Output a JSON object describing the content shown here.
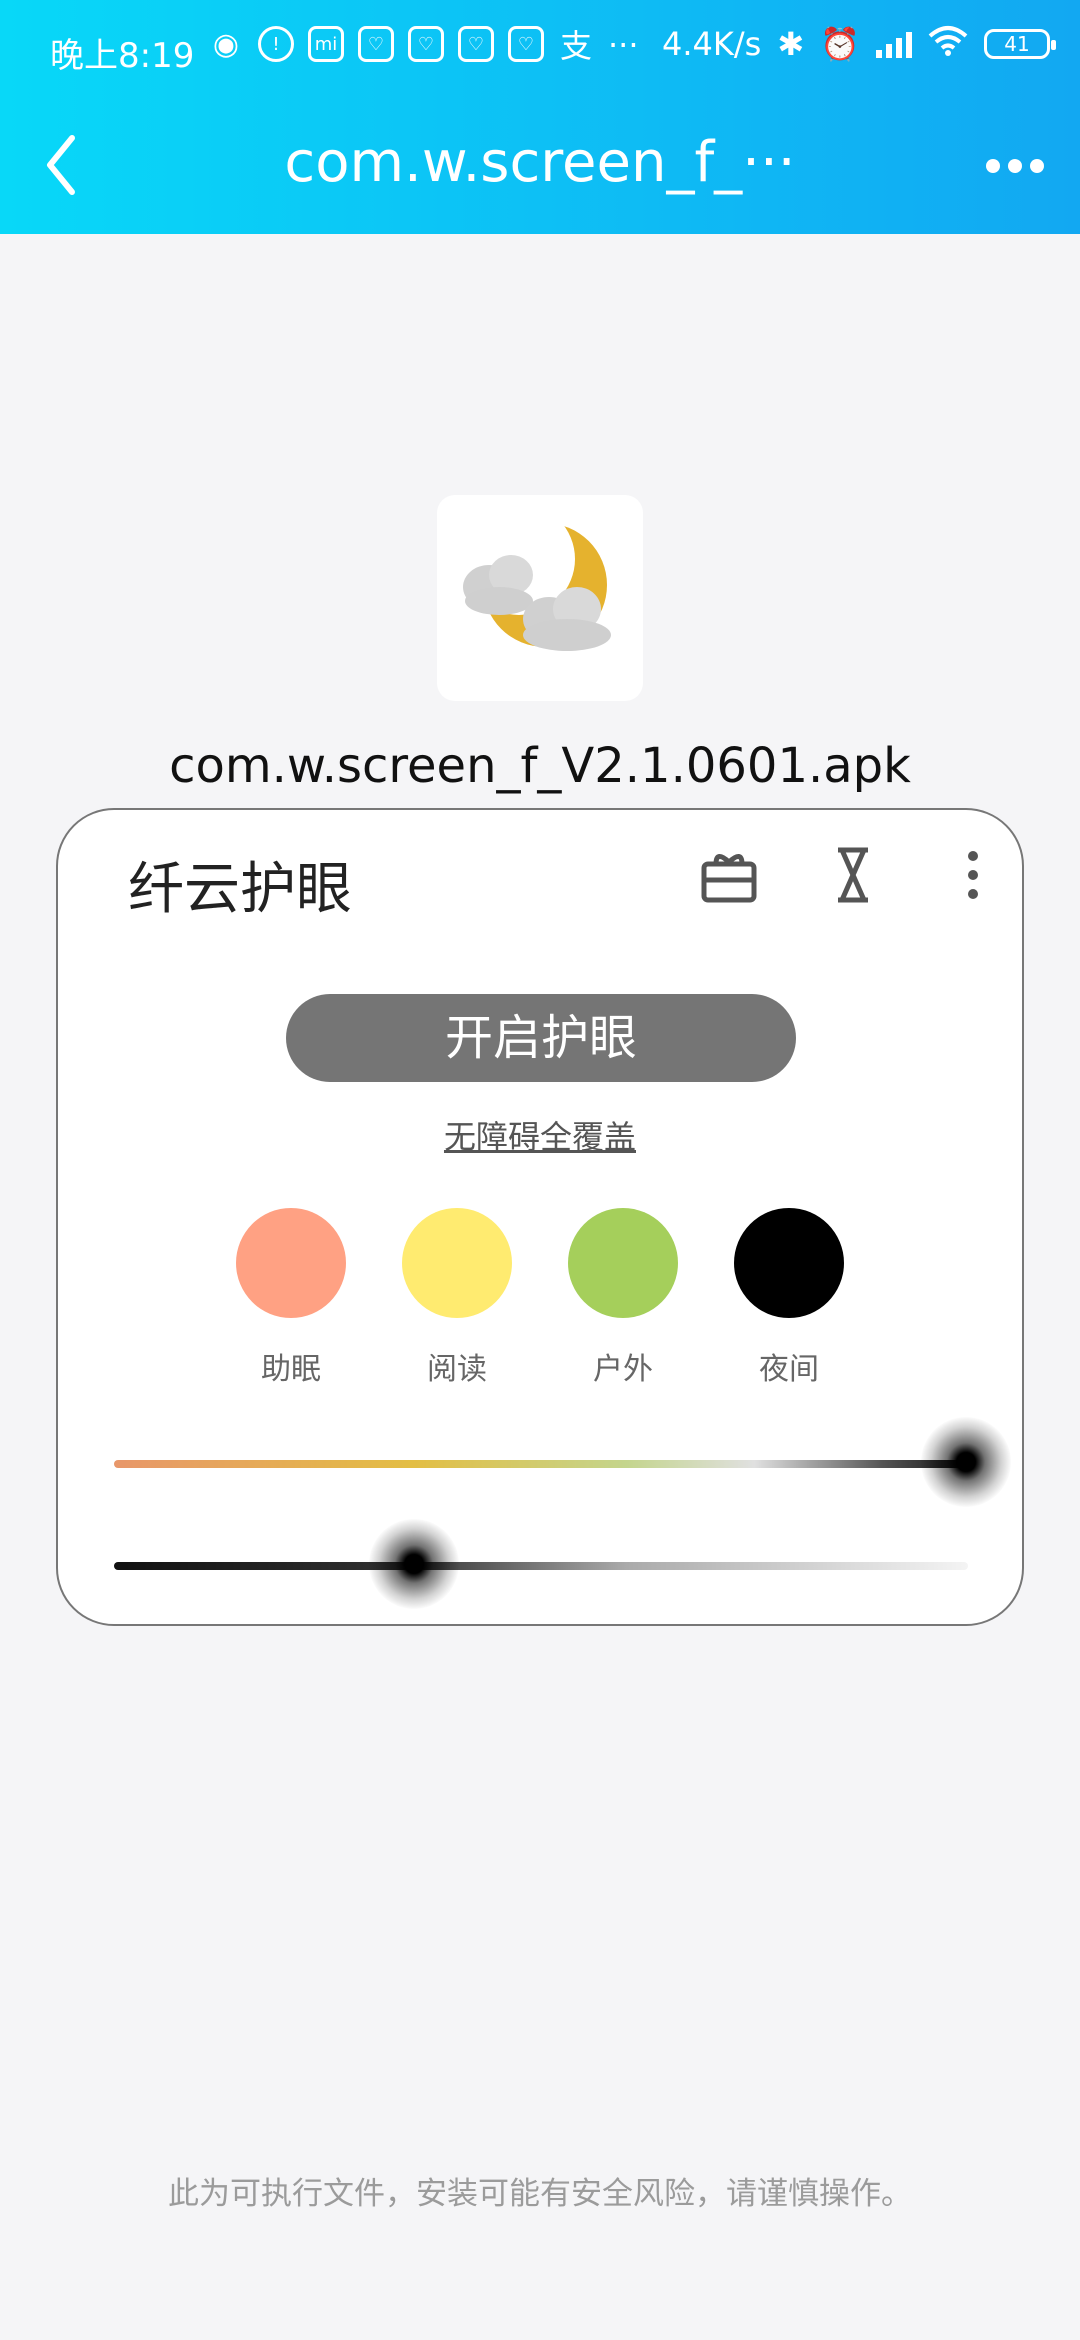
{
  "status_bar": {
    "time": "晚上8:19",
    "network_speed": "4.4K/s",
    "overflow": "···",
    "battery": "41",
    "icons": [
      "wechat-icon",
      "alert-icon",
      "mi-icon",
      "app-icon",
      "app-icon",
      "app-icon",
      "app-icon",
      "alipay-icon",
      "bluetooth-icon",
      "alarm-icon",
      "signal-icon",
      "wifi-icon",
      "battery-icon"
    ]
  },
  "header": {
    "title": "com.w.screen_f_···",
    "back_icon": "chevron-left-icon",
    "more_icon": "more-dots-icon"
  },
  "file": {
    "name": "com.w.screen_f_V2.1.0601.apk",
    "icon": "moon-cloud-icon"
  },
  "preview": {
    "app_title": "纤云护眼",
    "icons": [
      "gift-icon",
      "hourglass-icon",
      "vertical-dots-icon"
    ],
    "start_button": "开启护眼",
    "overlay_link": "无障碍全覆盖",
    "modes": [
      {
        "label": "助眠",
        "color": "#ffa183"
      },
      {
        "label": "阅读",
        "color": "#ffeb70"
      },
      {
        "label": "户外",
        "color": "#a5cf5b"
      },
      {
        "label": "夜间",
        "color": "#000000"
      }
    ],
    "slider_1_level": 1.0,
    "slider_2_level": 0.48
  },
  "footer": {
    "warning": "此为可执行文件，安装可能有安全风险，请谨慎操作。"
  }
}
